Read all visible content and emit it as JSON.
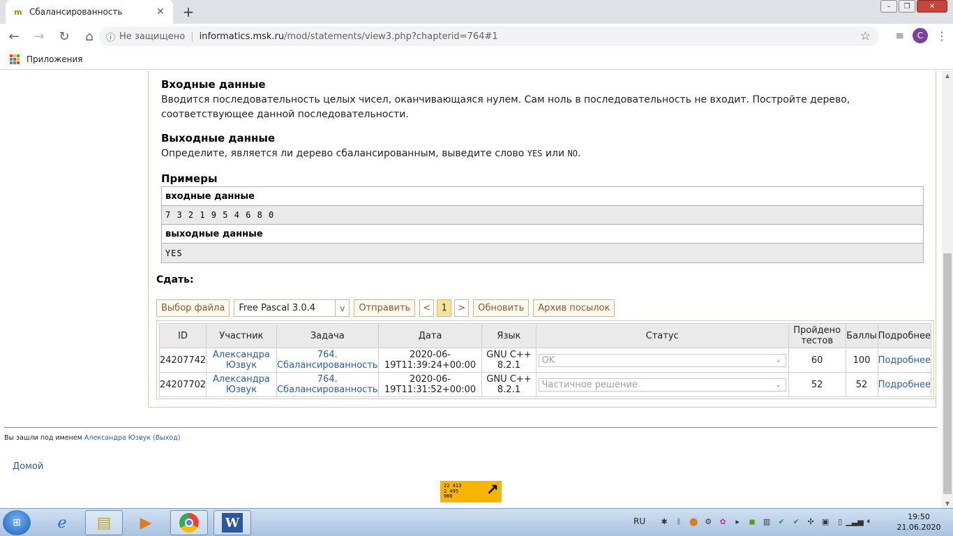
{
  "browser": {
    "tab_title": "Сбалансированность",
    "tab_favicon": "m",
    "tab_close": "✕",
    "new_tab": "+",
    "url_insecure": "Не защищено",
    "url_domain": "informatics.msk.ru",
    "url_path": "/mod/statements/view3.php?chapterid=764#1",
    "avatar_letter": "С",
    "bookmark_apps": "Приложения"
  },
  "problem": {
    "input_heading": "Входные данные",
    "input_text_1": "Вводится последовательность целых чисел, оканчивающаяся нулем. Сам ноль в последовательность не входит. Постройте дерево,",
    "input_text_2": "соответствующее данной последовательности.",
    "output_heading": "Выходные данные",
    "output_text_pre": "Определите, является ли дерево сбалансированным, выведите слово",
    "output_yes": "YES",
    "output_or": "или",
    "output_no": "NO",
    "output_dot": ".",
    "examples_heading": "Примеры",
    "example_input_label": "входные данные",
    "example_input_value": "7 3 2 1 9 5 4 6 8 0",
    "example_output_label": "выходные данные",
    "example_output_value": "YES"
  },
  "submit": {
    "heading": "Сдать:",
    "choose_file": "Выбор файла",
    "language": "Free Pascal 3.0.4",
    "language_arrow": "v",
    "send": "Отправить",
    "prev": "<",
    "page": "1",
    "next": ">",
    "refresh": "Обновить",
    "archive": "Архив посылок"
  },
  "results": {
    "headers": [
      "ID",
      "Участник",
      "Задача",
      "Дата",
      "Язык",
      "Статус",
      "Пройдено тестов",
      "Баллы",
      "Подробнее"
    ],
    "rows": [
      {
        "id": "24207742",
        "user_1": "Александра",
        "user_2": "Юзвук",
        "task_1": "764.",
        "task_2": "Сбалансированность",
        "date_1": "2020-06-",
        "date_2": "19T11:39:24+00:00",
        "lang_1": "GNU C++",
        "lang_2": "8.2.1",
        "status": "OK",
        "tests": "60",
        "score": "100",
        "details": "Подробнее"
      },
      {
        "id": "24207702",
        "user_1": "Александра",
        "user_2": "Юзвук",
        "task_1": "764.",
        "task_2": "Сбалансированность",
        "date_1": "2020-06-",
        "date_2": "19T11:31:52+00:00",
        "lang_1": "GNU C++",
        "lang_2": "8.2.1",
        "status": "Частичное решение",
        "tests": "52",
        "score": "52",
        "details": "Подробнее"
      }
    ]
  },
  "footer": {
    "logged_prefix": "Вы зашли под именем",
    "logged_user": "Александра Юзвук (Выход)",
    "home": "Домой",
    "counter_lines": [
      "22 413",
      "2 495",
      "966"
    ]
  },
  "taskbar": {
    "lang": "RU",
    "time": "19:50",
    "date": "21.06.2020"
  },
  "colors": {
    "link": "#2a5db0",
    "button_border": "#d4b58a",
    "active_page": "#f5e39a",
    "counter_bg": "#f7b500",
    "avatar_bg": "#7b3fa0"
  }
}
